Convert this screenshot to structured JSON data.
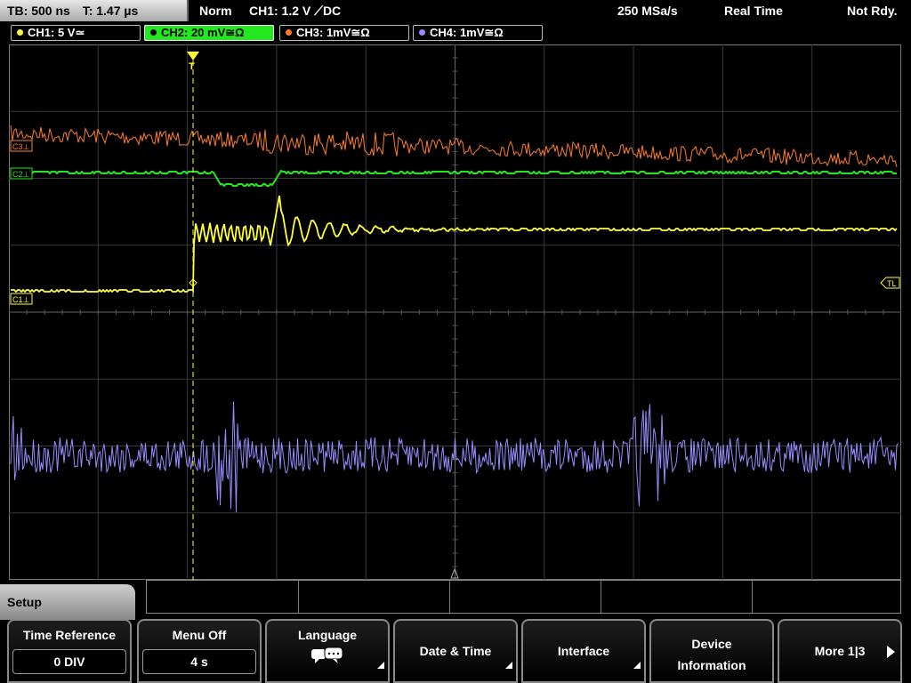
{
  "status": {
    "timebase": "TB: 500 ns",
    "trigger_time": "T: 1.47 µs",
    "mode": "Norm",
    "trigger": "CH1: 1.2 V ⟋DC",
    "sample_rate": "250 MSa/s",
    "acquisition": "Real Time",
    "state": "Not Rdy."
  },
  "channels": [
    {
      "label": "CH1: 5 V≃",
      "color": "#ffff3c"
    },
    {
      "label": "CH2: 20 mV≅Ω",
      "color": "#22e81f"
    },
    {
      "label": "CH3: 1mV≅Ω",
      "color": "#ff7f27"
    },
    {
      "label": "CH4: 1mV≅Ω",
      "color": "#9a8cff"
    }
  ],
  "markers": {
    "ch3": "C3⊥",
    "ch2": "C2⊥",
    "ch1": "C1⊥",
    "trigger_level": "TL",
    "trigger_pos": "T"
  },
  "menu": {
    "title": "Setup",
    "softkeys": {
      "time_reference": {
        "label": "Time Reference",
        "value": "0 DIV"
      },
      "menu_off": {
        "label": "Menu Off",
        "value": "4 s"
      },
      "language": {
        "label": "Language"
      },
      "date_time": {
        "label": "Date & Time"
      },
      "interface": {
        "label": "Interface"
      },
      "device_information": {
        "line1": "Device",
        "line2": "Information"
      },
      "more": {
        "label": "More 1|3"
      }
    }
  },
  "icons": {
    "language": "speech-bubbles-icon",
    "more": "arrow-right-icon",
    "submenu": "corner-triangle-icon"
  }
}
